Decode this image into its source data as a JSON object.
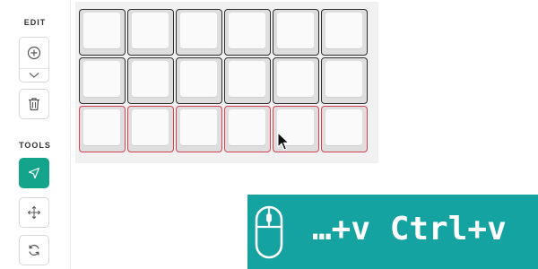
{
  "toolbar": {
    "edit_label": "EDIT",
    "tools_label": "TOOLS",
    "buttons": [
      {
        "name": "add",
        "icon": "plus-circle-icon"
      },
      {
        "name": "add-options",
        "icon": "chevron-down-icon"
      },
      {
        "name": "delete",
        "icon": "trash-icon"
      },
      {
        "name": "select",
        "icon": "pointer-arrow-icon",
        "active": true
      },
      {
        "name": "move",
        "icon": "move-arrows-icon"
      },
      {
        "name": "rotate",
        "icon": "rotate-icon"
      }
    ]
  },
  "colors": {
    "accent": "#14a38b",
    "overlay": "#14a3a1",
    "key_border": "#2e2e2e",
    "selected_border": "#d2414f"
  },
  "keyboard": {
    "rows": 3,
    "columns": 6,
    "selected_row": 3
  },
  "overlay": {
    "icon": "mouse-icon",
    "text": "…+v Ctrl+v"
  }
}
